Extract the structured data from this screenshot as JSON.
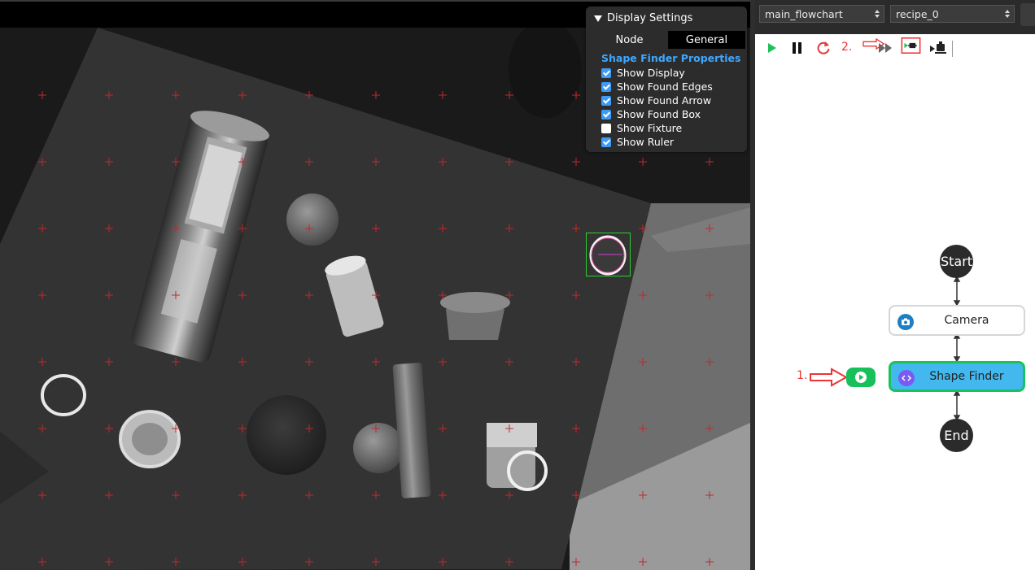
{
  "display_settings": {
    "title": "Display Settings",
    "tabs": [
      {
        "label": "Node",
        "active": false
      },
      {
        "label": "General",
        "active": true
      }
    ],
    "section_title": "Shape Finder Properties",
    "options": [
      {
        "label": "Show Display",
        "checked": true
      },
      {
        "label": "Show Found Edges",
        "checked": true
      },
      {
        "label": "Show Found Arrow",
        "checked": true
      },
      {
        "label": "Show Found Box",
        "checked": true
      },
      {
        "label": "Show Fixture",
        "checked": false
      },
      {
        "label": "Show Ruler",
        "checked": true
      }
    ]
  },
  "selectors": {
    "flowchart": "main_flowchart",
    "recipe": "recipe_0"
  },
  "toolbar": {
    "icons": [
      "play-icon",
      "pause-icon",
      "reset-icon",
      "step-over-icon",
      "run-to-node-icon",
      "debug-node-icon"
    ],
    "annotation_label": "2."
  },
  "flowchart": {
    "start_label": "Start",
    "camera_label": "Camera",
    "shape_finder_label": "Shape Finder",
    "end_label": "End",
    "annotation_label": "1."
  },
  "colors": {
    "accent_blue": "#3ea8ff",
    "node_selected_fill": "#43b8ee",
    "node_selected_border": "#18c45a",
    "run_green": "#17c05a",
    "annotation_red": "#e33333",
    "crosshair_red": "#c0282c"
  }
}
